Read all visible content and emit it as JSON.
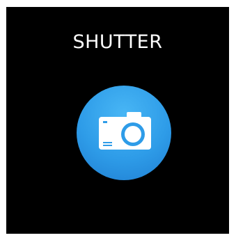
{
  "screen": {
    "title": "SHUTTER"
  },
  "shutter_button": {
    "icon": "camera-icon",
    "color": "#2e9ce8"
  }
}
